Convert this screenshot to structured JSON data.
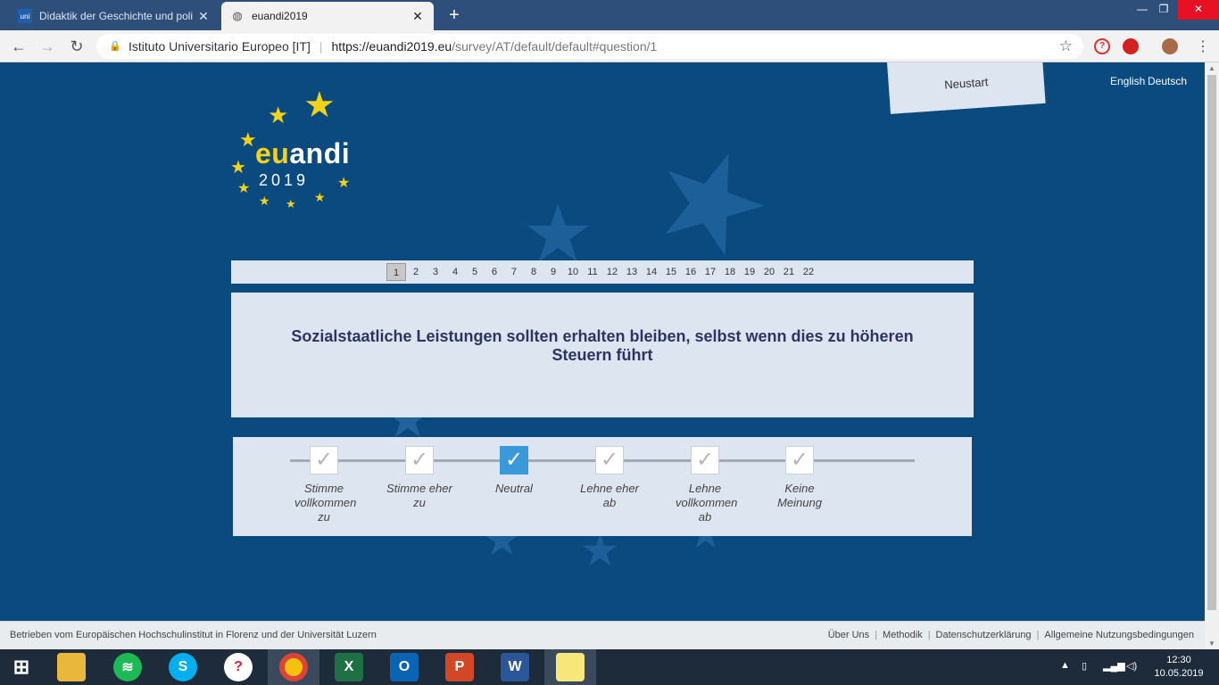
{
  "browser": {
    "tabs": [
      {
        "title": "Didaktik der Geschichte und poli",
        "favicon": "uni-wien-icon",
        "active": false
      },
      {
        "title": "euandi2019",
        "favicon": "globe-icon",
        "active": true
      }
    ],
    "site_org": "Istituto Universitario Europeo [IT]",
    "url_host": "https://euandi2019.eu",
    "url_path": "/survey/AT/default/default#question/1"
  },
  "header": {
    "restart_label": "Neustart",
    "languages": [
      "English",
      "Deutsch"
    ]
  },
  "logo": {
    "word_eu": "eu",
    "word_andi": "andi",
    "year": "2019"
  },
  "question_nav": {
    "current": 1,
    "numbers": [
      "1",
      "2",
      "3",
      "4",
      "5",
      "6",
      "7",
      "8",
      "9",
      "10",
      "11",
      "12",
      "13",
      "14",
      "15",
      "16",
      "17",
      "18",
      "19",
      "20",
      "21",
      "22"
    ]
  },
  "question": {
    "text": "Sozialstaatliche Leistungen sollten erhalten bleiben, selbst wenn dies zu höheren Steuern führt"
  },
  "answers": {
    "selected_index": 2,
    "options": [
      {
        "label": "Stimme vollkommen zu"
      },
      {
        "label": "Stimme eher zu"
      },
      {
        "label": "Neutral"
      },
      {
        "label": "Lehne eher ab"
      },
      {
        "label": "Lehne vollkommen ab"
      },
      {
        "label": "Keine Meinung"
      }
    ]
  },
  "footer": {
    "operator_text": "Betrieben vom Europäischen Hochschulinstitut in Florenz und der Universität Luzern",
    "links": [
      "Über Uns",
      "Methodik",
      "Datenschutzerklärung",
      "Allgemeine Nutzungsbedingungen"
    ]
  },
  "taskbar": {
    "time": "12:30",
    "date": "10.05.2019"
  },
  "colors": {
    "page_bg": "#0a4a7e",
    "panel_bg": "#dde6f0",
    "accent_checked": "#3a9ad9",
    "logo_yellow": "#f4d21a",
    "question_text": "#2b3560"
  }
}
